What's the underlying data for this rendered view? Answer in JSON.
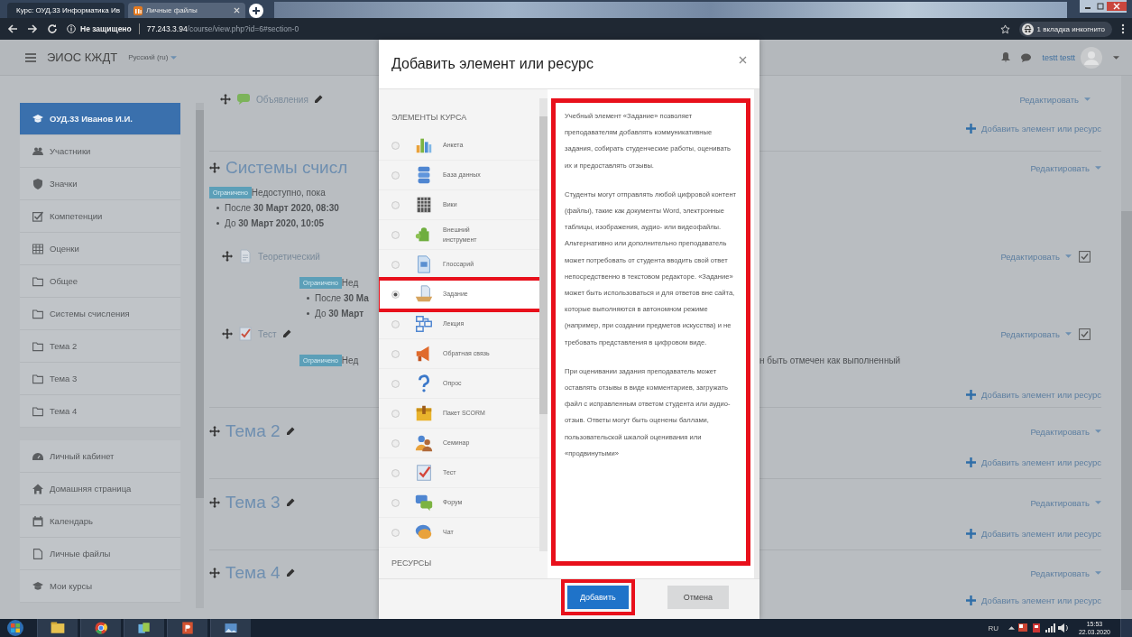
{
  "browser": {
    "tabs": [
      {
        "title": "Курс: ОУД.33 Информатика Ив",
        "selected": true
      },
      {
        "title": "Личные файлы",
        "selected": false
      }
    ],
    "security": "Не защищено",
    "host": "77.243.3.94",
    "path": "/course/view.php?id=6#section-0",
    "incognito": "1 вкладка инкогнито"
  },
  "navbar": {
    "site_name": "ЭИОС КЖДТ",
    "language": "Русский (ru)",
    "user": "testt testt"
  },
  "sidebar": {
    "groups": [
      {
        "items": [
          {
            "kind": "course",
            "label": "ОУД.33 Иванов И.И.",
            "selected": true
          },
          {
            "kind": "users",
            "label": "Участники",
            "selected": false
          },
          {
            "kind": "badge",
            "label": "Значки",
            "selected": false
          },
          {
            "kind": "competency",
            "label": "Компетенции",
            "selected": false
          },
          {
            "kind": "grades",
            "label": "Оценки",
            "selected": false
          },
          {
            "kind": "folder",
            "label": "Общее",
            "selected": false
          },
          {
            "kind": "folder",
            "label": "Системы счисления",
            "selected": false
          },
          {
            "kind": "folder",
            "label": "Тема 2",
            "selected": false
          },
          {
            "kind": "folder",
            "label": "Тема 3",
            "selected": false
          },
          {
            "kind": "folder",
            "label": "Тема 4",
            "selected": false
          }
        ]
      },
      {
        "items": [
          {
            "kind": "dashboard",
            "label": "Личный кабинет",
            "selected": false
          },
          {
            "kind": "home",
            "label": "Домашняя страница",
            "selected": false
          },
          {
            "kind": "calendar",
            "label": "Календарь",
            "selected": false
          },
          {
            "kind": "file",
            "label": "Личные файлы",
            "selected": false
          },
          {
            "kind": "course",
            "label": "Мои курсы",
            "selected": false
          }
        ]
      }
    ]
  },
  "course": {
    "sections": [
      {
        "activities": [
          {
            "kind": "forum",
            "title": "Объявления",
            "editable": true,
            "edit": "Редактировать",
            "completion": false
          }
        ],
        "add": "Добавить элемент или ресурс"
      },
      {
        "title": "Системы счисл",
        "editable": false,
        "edit": "Редактировать",
        "restriction": {
          "badge": "Ограничено",
          "text": "Недоступно, пока",
          "conditions": [
            "После **30 Март 2020, 08:30**",
            "До **30 Март 2020, 10:05**"
          ]
        },
        "activities": [
          {
            "kind": "page",
            "title": "Теоретический",
            "editable": false,
            "edit": "Редактировать",
            "completion": true,
            "restriction": {
              "badge": "Ограничено",
              "text": "Нед",
              "conditions": [
                "После **30 Ма**",
                "До **30 Март**"
              ]
            }
          },
          {
            "kind": "quiz",
            "title": "Тест",
            "editable": true,
            "edit": "Редактировать",
            "completion": true,
            "restriction": {
              "badge": "Ограничено",
              "text": "Нед"
            },
            "note": "н быть отмечен как выполненный"
          }
        ],
        "add": "Добавить элемент или ресурс"
      },
      {
        "title": "Тема 2",
        "editable": true,
        "edit": "Редактировать",
        "add": "Добавить элемент или ресурс"
      },
      {
        "title": "Тема 3",
        "editable": true,
        "edit": "Редактировать",
        "add": "Добавить элемент или ресурс"
      },
      {
        "title": "Тема 4",
        "editable": true,
        "edit": "Редактировать",
        "add": "Добавить элемент или ресурс"
      }
    ]
  },
  "modal": {
    "title": "Добавить элемент или ресурс",
    "group_heading": "ЭЛЕМЕНТЫ КУРСА",
    "modules": [
      {
        "kind": "survey",
        "label": "Анкета",
        "selected": false,
        "highlighted": false
      },
      {
        "kind": "database",
        "label": "База данных",
        "selected": false,
        "highlighted": false
      },
      {
        "kind": "wiki",
        "label": "Вики",
        "selected": false,
        "highlighted": false
      },
      {
        "kind": "external",
        "label": "Внешний инструмент",
        "selected": false,
        "highlighted": false
      },
      {
        "kind": "glossary",
        "label": "Глоссарий",
        "selected": false,
        "highlighted": false
      },
      {
        "kind": "assignment",
        "label": "Задание",
        "selected": true,
        "highlighted": true
      },
      {
        "kind": "lesson",
        "label": "Лекция",
        "selected": false,
        "highlighted": false
      },
      {
        "kind": "feedback",
        "label": "Обратная связь",
        "selected": false,
        "highlighted": false
      },
      {
        "kind": "choice",
        "label": "Опрос",
        "selected": false,
        "highlighted": false
      },
      {
        "kind": "scorm",
        "label": "Пакет SCORM",
        "selected": false,
        "highlighted": false
      },
      {
        "kind": "workshop",
        "label": "Семинар",
        "selected": false,
        "highlighted": false
      },
      {
        "kind": "quiz",
        "label": "Тест",
        "selected": false,
        "highlighted": false
      },
      {
        "kind": "forum",
        "label": "Форум",
        "selected": false,
        "highlighted": false
      },
      {
        "kind": "chat",
        "label": "Чат",
        "selected": false,
        "highlighted": false
      }
    ],
    "resources_heading": "РЕСУРСЫ",
    "description": {
      "highlighted": true,
      "paragraphs": [
        "Учебный элемент «Задание» позволяет преподавателям добавлять коммуникативные задания, собирать студенческие работы, оценивать их и предоставлять отзывы.",
        "Студенты могут отправлять любой цифровой контент (файлы), такие как документы Word, электронные таблицы, изображения, аудио- или видеофайлы. Альтернативно или дополнительно преподаватель может потребовать от студента вводить свой ответ непосредственно в текстовом редакторе. «Задание» может быть использоваться и для ответов вне сайта, которые выполняются в автономном режиме (например, при создании предметов искусства) и не требовать представления в цифровом виде.",
        "При оценивании задания преподаватель может оставлять отзывы в виде комментариев, загружать файл с исправленным ответом студента или аудио-отзыв. Ответы могут быть оценены баллами, пользовательской шкалой оценивания или «продвинутыми»"
      ]
    },
    "buttons": [
      {
        "kind": "primary",
        "label": "Добавить",
        "highlighted": true
      },
      {
        "kind": "secondary",
        "label": "Отмена",
        "highlighted": false
      }
    ]
  },
  "taskbar": {
    "language": "RU",
    "time": "15:53",
    "date": "22.03.2020"
  }
}
